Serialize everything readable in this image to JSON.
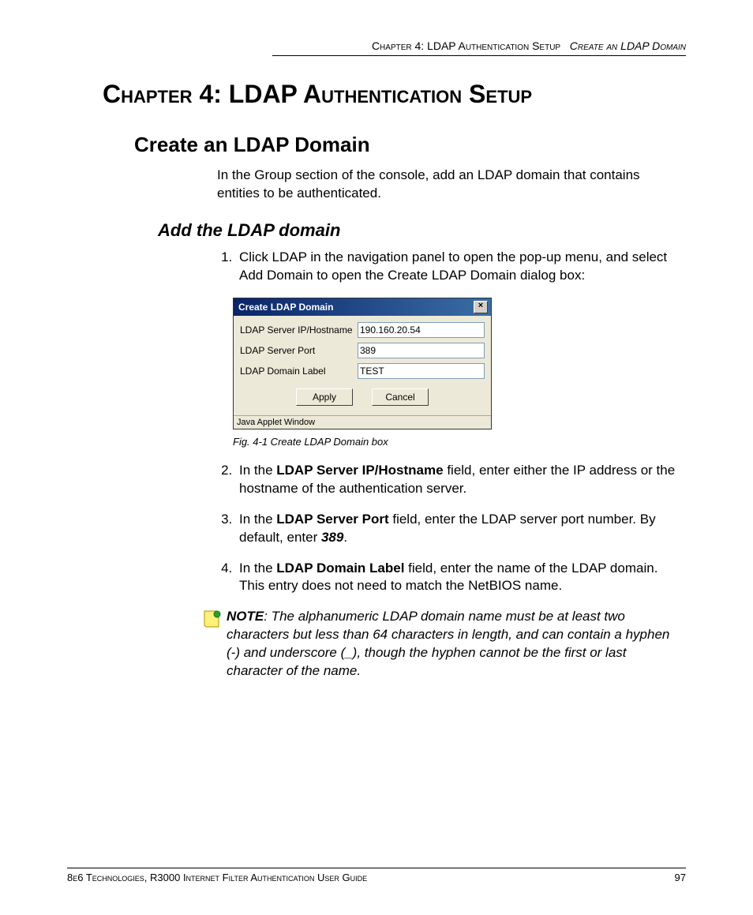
{
  "header": {
    "chapter_label": "Chapter 4: LDAP Authentication Setup",
    "section_label": "Create an LDAP Domain"
  },
  "chapter_title": "Chapter 4: LDAP Authentication Setup",
  "section_title": "Create an LDAP Domain",
  "intro_paragraph": "In the Group section of the console, add an LDAP domain that contains entities to be authenticated.",
  "subsection_title": "Add the LDAP domain",
  "steps": {
    "s1": "Click LDAP in the navigation panel to open the pop-up menu, and select Add Domain to open the Create LDAP Domain dialog box:",
    "s2_pre": "In the ",
    "s2_bold": "LDAP Server IP/Hostname",
    "s2_post": " field, enter either the IP address or the hostname of the authentication server.",
    "s3_pre": "In the ",
    "s3_bold": "LDAP Server Port",
    "s3_mid": " field, enter the LDAP server port number. By default, enter ",
    "s3_em": "389",
    "s3_post": ".",
    "s4_pre": "In the ",
    "s4_bold": "LDAP Domain Label",
    "s4_post": " field, enter the name of the LDAP domain. This entry does not need to match the NetBIOS name."
  },
  "dialog": {
    "title": "Create LDAP Domain",
    "row1_label": "LDAP Server IP/Hostname",
    "row1_value": "190.160.20.54",
    "row2_label": "LDAP Server Port",
    "row2_value": "389",
    "row3_label": "LDAP Domain Label",
    "row3_value": "TEST",
    "apply": "Apply",
    "cancel": "Cancel",
    "applet": "Java Applet Window"
  },
  "caption": "Fig. 4-1  Create LDAP Domain box",
  "note": {
    "label": "NOTE",
    "text": ": The alphanumeric LDAP domain name must be at least two characters but less than 64 characters in length, and can contain a  hyphen (-) and underscore (_), though the hyphen cannot be the first or last character of the name."
  },
  "footer": {
    "left": "8e6 Technologies, R3000 Internet Filter Authentication User Guide",
    "right": "97"
  }
}
